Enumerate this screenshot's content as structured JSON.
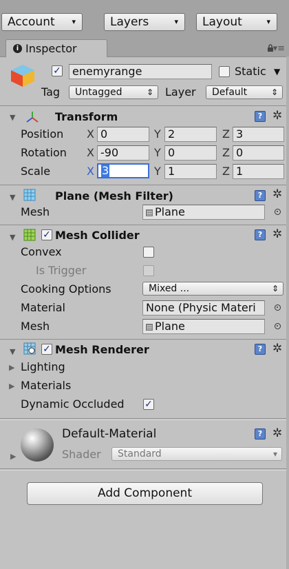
{
  "toolbar": {
    "account_label": "Account",
    "layers_label": "Layers",
    "layout_label": "Layout",
    "arrow": "▾"
  },
  "tab": {
    "label": "Inspector",
    "info_glyph": "i"
  },
  "object": {
    "name": "enemyrange",
    "active": true,
    "static_label": "Static",
    "static_checked": false,
    "tag_label": "Tag",
    "tag_value": "Untagged",
    "layer_label": "Layer",
    "layer_value": "Default"
  },
  "transform": {
    "title": "Transform",
    "position_label": "Position",
    "rotation_label": "Rotation",
    "scale_label": "Scale",
    "axis_x": "X",
    "axis_y": "Y",
    "axis_z": "Z",
    "position": {
      "x": "0",
      "y": "2",
      "z": "3"
    },
    "rotation": {
      "x": "-90",
      "y": "0",
      "z": "0"
    },
    "scale": {
      "x": "3",
      "y": "1",
      "z": "1"
    }
  },
  "mesh_filter": {
    "title": "Plane (Mesh Filter)",
    "mesh_label": "Mesh",
    "mesh_value": "Plane"
  },
  "mesh_collider": {
    "title": "Mesh Collider",
    "enabled": true,
    "convex_label": "Convex",
    "convex": false,
    "is_trigger_label": "Is Trigger",
    "is_trigger": false,
    "cooking_label": "Cooking Options",
    "cooking_value": "Mixed ...",
    "material_label": "Material",
    "material_value": "None (Physic Materi",
    "mesh_label": "Mesh",
    "mesh_value": "Plane"
  },
  "mesh_renderer": {
    "title": "Mesh Renderer",
    "enabled": true,
    "lighting_label": "Lighting",
    "materials_label": "Materials",
    "dynamic_occluded_label": "Dynamic Occluded",
    "dynamic_occluded": true
  },
  "material": {
    "name": "Default-Material",
    "shader_label": "Shader",
    "shader_value": "Standard"
  },
  "add_component_label": "Add Component",
  "glyphs": {
    "check": "✓",
    "help": "?",
    "gear": "✲",
    "foldout": "▼",
    "collapsed": "▶",
    "updown": "⇕",
    "lock": "🔒",
    "menu": "▾≡"
  }
}
